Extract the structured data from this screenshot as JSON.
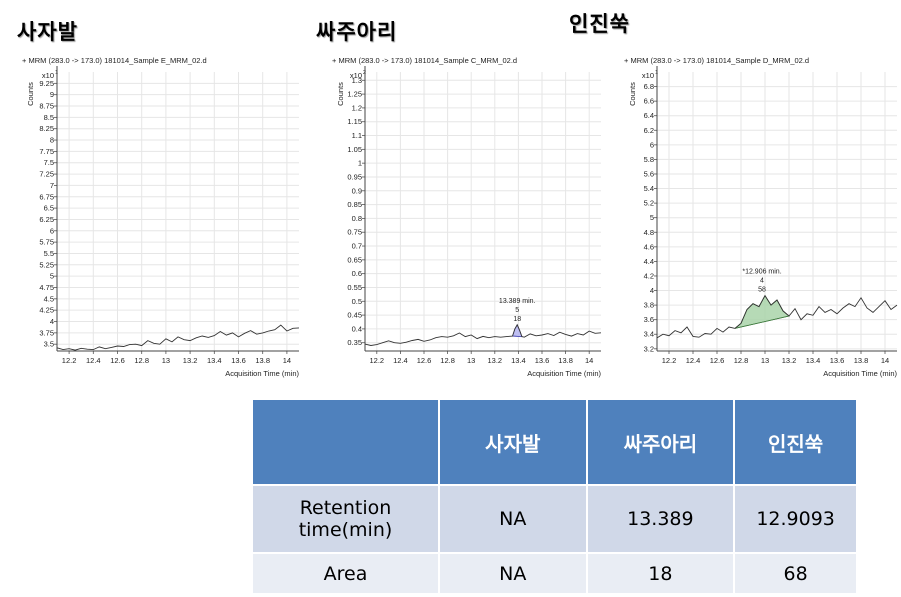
{
  "titles": [
    "사자발",
    "싸주아리",
    "인진쑥"
  ],
  "table": {
    "headers": [
      "",
      "사자발",
      "싸주아리",
      "인진쑥"
    ],
    "rows": [
      {
        "label": "Retention time(min)",
        "label_lines": [
          "Retention",
          "time(min)"
        ],
        "values": [
          "NA",
          "13.389",
          "12.9093"
        ]
      },
      {
        "label": "Area",
        "values": [
          "NA",
          "18",
          "68"
        ]
      }
    ]
  },
  "chart_data": [
    {
      "type": "line",
      "sample_title": "사자발",
      "title": "+ MRM (283.0 -> 173.0) 181014_Sample E_MRM_02.d",
      "ylabel": "Counts",
      "yscale_label": "x10",
      "yscale_exp": "1",
      "xlabel": "Acquisition Time (min)",
      "xlim": [
        12.1,
        14.1
      ],
      "ylim": [
        3.35,
        9.5
      ],
      "xticks": [
        12.2,
        12.4,
        12.6,
        12.8,
        13,
        13.2,
        13.4,
        13.6,
        13.8,
        14
      ],
      "xtick_labels": [
        "12.2",
        "12.4",
        "12.6",
        "12.8",
        "13",
        "13.2",
        "13.4",
        "13.6",
        "13.8",
        "14"
      ],
      "yticks": [
        3.5,
        3.75,
        4,
        4.25,
        4.5,
        4.75,
        5,
        5.25,
        5.5,
        5.75,
        6,
        6.25,
        6.5,
        6.75,
        7,
        7.25,
        7.5,
        7.75,
        8,
        8.25,
        8.5,
        8.75,
        9,
        9.25
      ],
      "ytick_labels": [
        "3.5",
        "3.75",
        "4",
        "4.25",
        "4.5",
        "4.75",
        "5",
        "5.25",
        "5.5",
        "5.75",
        "6",
        "6.25",
        "6.5",
        "6.75",
        "7",
        "7.25",
        "7.5",
        "7.75",
        "8",
        "8.25",
        "8.5",
        "8.75",
        "9",
        "9.25"
      ],
      "series": [
        {
          "name": "trace",
          "x": [
            12.1,
            12.15,
            12.2,
            12.25,
            12.3,
            12.35,
            12.4,
            12.45,
            12.5,
            12.55,
            12.6,
            12.65,
            12.7,
            12.75,
            12.8,
            12.85,
            12.9,
            12.95,
            13.0,
            13.05,
            13.1,
            13.15,
            13.2,
            13.25,
            13.3,
            13.35,
            13.4,
            13.45,
            13.5,
            13.55,
            13.6,
            13.65,
            13.7,
            13.75,
            13.8,
            13.85,
            13.9,
            13.95,
            14.0,
            14.05,
            14.1
          ],
          "y": [
            3.42,
            3.38,
            3.4,
            3.37,
            3.41,
            3.39,
            3.38,
            3.44,
            3.4,
            3.43,
            3.46,
            3.45,
            3.49,
            3.5,
            3.47,
            3.58,
            3.52,
            3.5,
            3.62,
            3.55,
            3.66,
            3.6,
            3.58,
            3.64,
            3.68,
            3.65,
            3.69,
            3.78,
            3.7,
            3.75,
            3.66,
            3.74,
            3.8,
            3.72,
            3.75,
            3.79,
            3.82,
            3.92,
            3.79,
            3.85,
            3.86
          ]
        }
      ],
      "peak": null
    },
    {
      "type": "line",
      "sample_title": "싸주아리",
      "title": "+ MRM (283.0 -> 173.0) 181014_Sample C_MRM_02.d",
      "ylabel": "Counts",
      "yscale_label": "x10",
      "yscale_exp": "2",
      "xlabel": "Acquisition Time (min)",
      "xlim": [
        12.1,
        14.1
      ],
      "ylim": [
        0.32,
        1.33
      ],
      "xticks": [
        12.2,
        12.4,
        12.6,
        12.8,
        13,
        13.2,
        13.4,
        13.6,
        13.8,
        14
      ],
      "xtick_labels": [
        "12.2",
        "12.4",
        "12.6",
        "12.8",
        "13",
        "13.2",
        "13.4",
        "13.6",
        "13.8",
        "14"
      ],
      "yticks": [
        0.35,
        0.4,
        0.45,
        0.5,
        0.55,
        0.6,
        0.65,
        0.7,
        0.75,
        0.8,
        0.85,
        0.9,
        0.95,
        1,
        1.05,
        1.1,
        1.15,
        1.2,
        1.25,
        1.3
      ],
      "ytick_labels": [
        "0.35",
        "0.4",
        "0.45",
        "0.5",
        "0.55",
        "0.6",
        "0.65",
        "0.7",
        "0.75",
        "0.8",
        "0.85",
        "0.9",
        "0.95",
        "1",
        "1.05",
        "1.1",
        "1.15",
        "1.2",
        "1.25",
        "1.3"
      ],
      "series": [
        {
          "name": "trace",
          "x": [
            12.1,
            12.15,
            12.2,
            12.25,
            12.3,
            12.35,
            12.4,
            12.45,
            12.5,
            12.55,
            12.6,
            12.65,
            12.7,
            12.75,
            12.8,
            12.85,
            12.9,
            12.95,
            13.0,
            13.05,
            13.1,
            13.15,
            13.2,
            13.25,
            13.3,
            13.35,
            13.37,
            13.39,
            13.41,
            13.43,
            13.45,
            13.5,
            13.55,
            13.6,
            13.65,
            13.7,
            13.75,
            13.8,
            13.85,
            13.9,
            13.95,
            14.0,
            14.05,
            14.1
          ],
          "y": [
            0.345,
            0.34,
            0.343,
            0.35,
            0.357,
            0.35,
            0.348,
            0.352,
            0.358,
            0.362,
            0.355,
            0.36,
            0.368,
            0.372,
            0.37,
            0.375,
            0.385,
            0.372,
            0.378,
            0.365,
            0.373,
            0.368,
            0.372,
            0.37,
            0.372,
            0.374,
            0.4,
            0.415,
            0.395,
            0.372,
            0.37,
            0.382,
            0.375,
            0.378,
            0.383,
            0.376,
            0.388,
            0.38,
            0.374,
            0.383,
            0.378,
            0.392,
            0.384,
            0.386
          ]
        }
      ],
      "peak": {
        "rt_label": "13.389 min.",
        "label_line2": "5",
        "label_line3": "18",
        "x_start": 13.35,
        "x_end": 13.43,
        "fill": "#b4b4f0",
        "stroke": "#5555bb"
      }
    },
    {
      "type": "line",
      "sample_title": "인진쑥",
      "title": "+ MRM (283.0 -> 173.0) 181014_Sample D_MRM_02.d",
      "ylabel": "Counts",
      "yscale_label": "x10",
      "yscale_exp": "1",
      "xlabel": "Acquisition Time (min)",
      "xlim": [
        12.1,
        14.1
      ],
      "ylim": [
        3.17,
        7.0
      ],
      "xticks": [
        12.2,
        12.4,
        12.6,
        12.8,
        13,
        13.2,
        13.4,
        13.6,
        13.8,
        14
      ],
      "xtick_labels": [
        "12.2",
        "12.4",
        "12.6",
        "12.8",
        "13",
        "13.2",
        "13.4",
        "13.6",
        "13.8",
        "14"
      ],
      "yticks": [
        3.2,
        3.4,
        3.6,
        3.8,
        4,
        4.2,
        4.4,
        4.6,
        4.8,
        5,
        5.2,
        5.4,
        5.6,
        5.8,
        6,
        6.2,
        6.4,
        6.6,
        6.8
      ],
      "ytick_labels": [
        "3.2",
        "3.4",
        "3.6",
        "3.8",
        "4",
        "4.2",
        "4.4",
        "4.6",
        "4.8",
        "5",
        "5.2",
        "5.4",
        "5.6",
        "5.8",
        "6",
        "6.2",
        "6.4",
        "6.6",
        "6.8"
      ],
      "series": [
        {
          "name": "trace",
          "x": [
            12.1,
            12.15,
            12.2,
            12.25,
            12.3,
            12.35,
            12.4,
            12.45,
            12.5,
            12.55,
            12.6,
            12.65,
            12.7,
            12.75,
            12.8,
            12.85,
            12.9,
            12.95,
            13.0,
            13.05,
            13.1,
            13.15,
            13.2,
            13.25,
            13.3,
            13.35,
            13.4,
            13.45,
            13.5,
            13.55,
            13.6,
            13.65,
            13.7,
            13.75,
            13.8,
            13.85,
            13.9,
            13.95,
            14.0,
            14.05,
            14.1
          ],
          "y": [
            3.35,
            3.4,
            3.38,
            3.45,
            3.42,
            3.5,
            3.37,
            3.36,
            3.41,
            3.4,
            3.48,
            3.43,
            3.5,
            3.48,
            3.55,
            3.74,
            3.82,
            3.78,
            3.93,
            3.8,
            3.87,
            3.72,
            3.65,
            3.75,
            3.6,
            3.68,
            3.66,
            3.78,
            3.7,
            3.74,
            3.68,
            3.76,
            3.82,
            3.78,
            3.9,
            3.76,
            3.7,
            3.78,
            3.86,
            3.74,
            3.8
          ]
        }
      ],
      "peak": {
        "rt_label": "*12.906 min.",
        "label_line2": "4",
        "label_line3": "58",
        "x_start": 12.75,
        "x_end": 13.2,
        "fill": "#a9d4a9",
        "stroke": "#3e7a3e"
      }
    }
  ]
}
